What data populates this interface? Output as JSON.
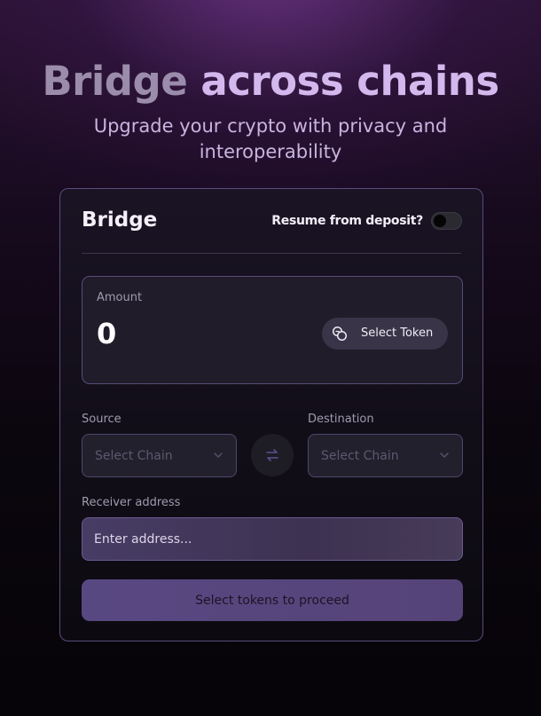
{
  "hero": {
    "title_part1": "Bridge",
    "title_part2": "across chains",
    "subtitle": "Upgrade your crypto with privacy and interoperability"
  },
  "card": {
    "title": "Bridge",
    "resume_label": "Resume from deposit?",
    "resume_toggle_on": false
  },
  "amount": {
    "label": "Amount",
    "value": "0",
    "select_token_label": "Select Token"
  },
  "source": {
    "label": "Source",
    "placeholder": "Select Chain"
  },
  "destination": {
    "label": "Destination",
    "placeholder": "Select Chain"
  },
  "receiver": {
    "label": "Receiver address",
    "placeholder": "Enter address..."
  },
  "proceed": {
    "label": "Select tokens to proceed"
  },
  "icons": {
    "token": "coins-icon",
    "swap": "swap-arrows-icon",
    "chevron": "chevron-down-icon"
  },
  "colors": {
    "accent": "#584882",
    "card_border": "#5a4c7c",
    "title_light": "#d2b8ec"
  }
}
